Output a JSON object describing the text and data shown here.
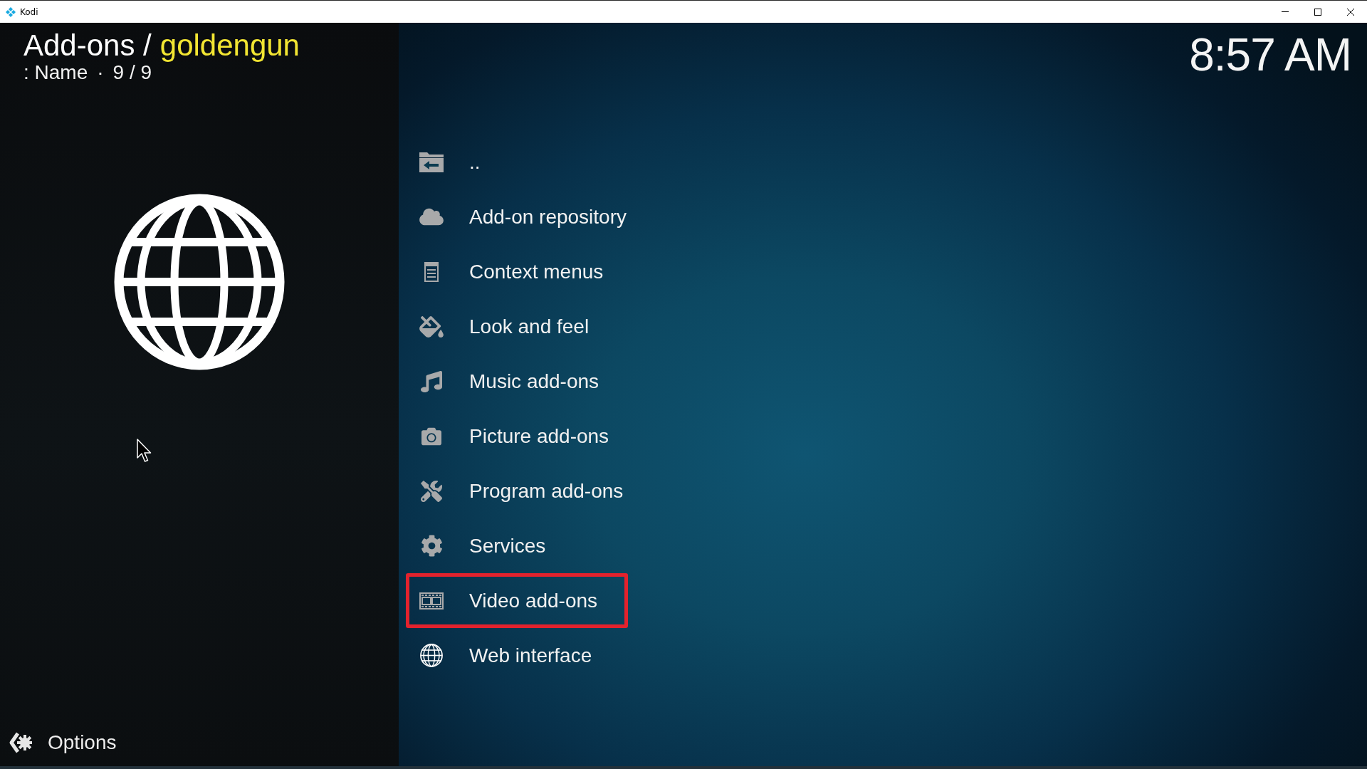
{
  "window": {
    "title": "Kodi"
  },
  "header": {
    "section": "Add-ons /",
    "current": "goldengun",
    "sort": ": Name",
    "separator": "·",
    "count": "9 / 9"
  },
  "clock": "8:57 AM",
  "items": [
    {
      "kind": "parent",
      "label": "..",
      "highlighted": false
    },
    {
      "kind": "repository",
      "label": "Add-on repository",
      "highlighted": false
    },
    {
      "kind": "context",
      "label": "Context menus",
      "highlighted": false
    },
    {
      "kind": "skin",
      "label": "Look and feel",
      "highlighted": false
    },
    {
      "kind": "music",
      "label": "Music add-ons",
      "highlighted": false
    },
    {
      "kind": "picture",
      "label": "Picture add-ons",
      "highlighted": false
    },
    {
      "kind": "program",
      "label": "Program add-ons",
      "highlighted": false
    },
    {
      "kind": "service",
      "label": "Services",
      "highlighted": false
    },
    {
      "kind": "video",
      "label": "Video add-ons",
      "highlighted": true
    },
    {
      "kind": "web",
      "label": "Web interface",
      "highlighted": false
    }
  ],
  "footer": {
    "options": "Options"
  }
}
